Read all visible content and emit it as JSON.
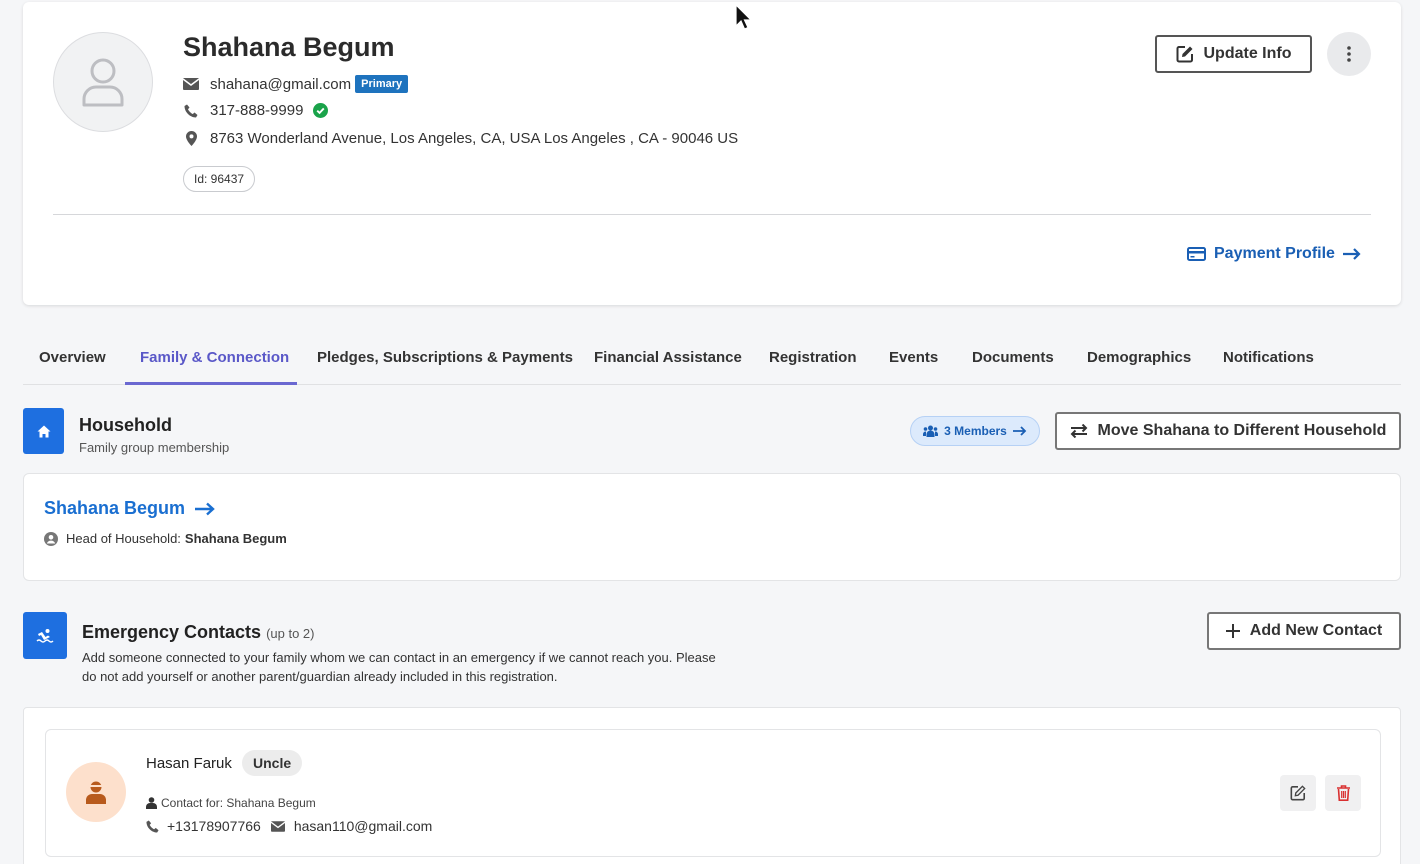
{
  "profile": {
    "name": "Shahana Begum",
    "email": "shahana@gmail.com",
    "email_badge": "Primary",
    "phone": "317-888-9999",
    "address": "8763 Wonderland Avenue, Los Angeles, CA, USA Los Angeles , CA - 90046 US",
    "id_label": "Id: 96437",
    "update_button": "Update Info",
    "payment_profile": "Payment Profile"
  },
  "tabs": [
    {
      "label": "Overview"
    },
    {
      "label": "Family & Connection",
      "active": true
    },
    {
      "label": "Pledges, Subscriptions & Payments"
    },
    {
      "label": "Financial Assistance"
    },
    {
      "label": "Registration"
    },
    {
      "label": "Events"
    },
    {
      "label": "Documents"
    },
    {
      "label": "Demographics"
    },
    {
      "label": "Notifications"
    }
  ],
  "household": {
    "title": "Household",
    "subtitle": "Family group membership",
    "members_pill": "3 Members",
    "move_button": "Move Shahana to Different Household",
    "name_link": "Shahana Begum",
    "head_label": "Head of Household:",
    "head_name": "Shahana Begum"
  },
  "emergency": {
    "title": "Emergency Contacts",
    "limit": "(up to 2)",
    "description": "Add someone connected to your family whom we can contact in an emergency if we cannot reach you. Please do not add yourself or another parent/guardian already included in this registration.",
    "add_button": "Add New Contact",
    "contacts": [
      {
        "name": "Hasan Faruk",
        "relationship": "Uncle",
        "contact_for": "Contact for: Shahana Begum",
        "phone": "+13178907766",
        "email": "hasan110@gmail.com"
      }
    ]
  },
  "colors": {
    "accent_blue": "#1e6fe0",
    "link_blue": "#1a5fb4",
    "active_tab": "#5a58c8",
    "primary_badge": "#1e73be",
    "verified_green": "#1aa34a",
    "delete_red": "#d93030"
  }
}
